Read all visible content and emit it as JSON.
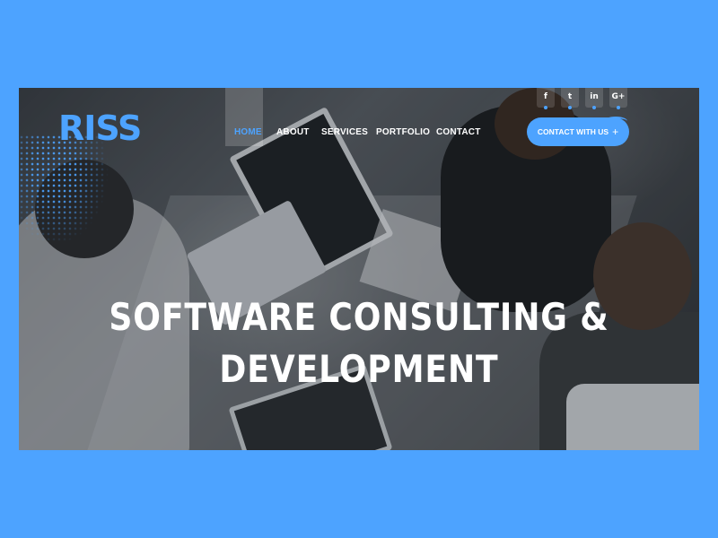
{
  "brand": {
    "logo_text": "RISS",
    "accent_color": "#4da3ff"
  },
  "nav": {
    "items": [
      {
        "label": "HOME",
        "active": true
      },
      {
        "label": "ABOUT",
        "active": false
      },
      {
        "label": "SERVICES",
        "active": false
      },
      {
        "label": "PORTFOLIO",
        "active": false
      },
      {
        "label": "CONTACT",
        "active": false
      }
    ]
  },
  "social": [
    {
      "icon": "facebook-icon",
      "glyph": "f"
    },
    {
      "icon": "twitter-icon",
      "glyph": "t"
    },
    {
      "icon": "linkedin-icon",
      "glyph": "in"
    },
    {
      "icon": "google-plus-icon",
      "glyph": "G+"
    }
  ],
  "cta": {
    "label": "CONTACT WITH US",
    "icon": "plus-icon",
    "glyph": "+"
  },
  "hero": {
    "headline_line1": "SOFTWARE CONSULTING &",
    "headline_line2": "DEVELOPMENT"
  },
  "colors": {
    "page_background": "#4da3ff",
    "text": "#ffffff"
  }
}
